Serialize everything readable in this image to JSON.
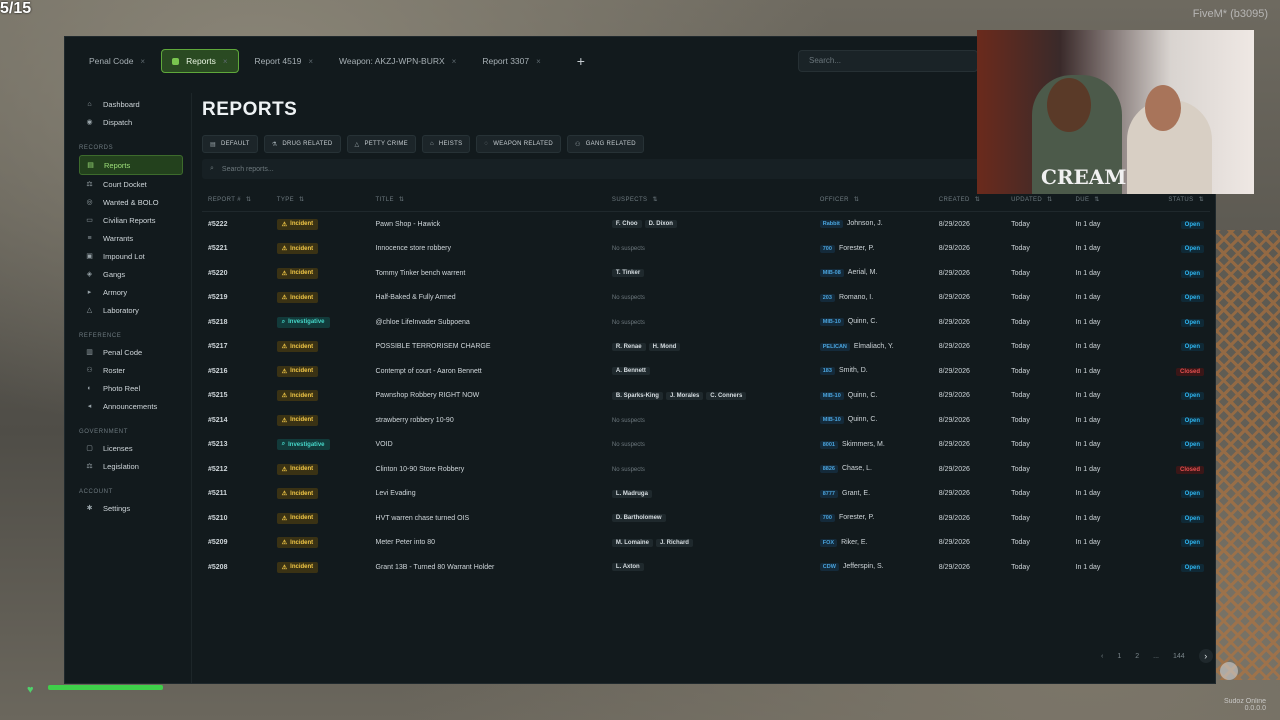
{
  "overlay": {
    "counter": "5/15",
    "server": "FiveM* (b3095)",
    "bottom_tag_1": "Sudoz Online",
    "bottom_tag_2": "0.0.0.0"
  },
  "webcam": {
    "shirt_text": "CREAM"
  },
  "tabs": [
    {
      "label": "Penal Code",
      "active": false
    },
    {
      "label": "Reports",
      "active": true
    },
    {
      "label": "Report 4519",
      "active": false
    },
    {
      "label": "Weapon: AKZJ-WPN-BURX",
      "active": false
    },
    {
      "label": "Report 3307",
      "active": false
    }
  ],
  "top_search_placeholder": "Search...",
  "sidebar": {
    "main": [
      {
        "label": "Dashboard",
        "icon": "home-icon"
      },
      {
        "label": "Dispatch",
        "icon": "radio-icon"
      }
    ],
    "records_title": "RECORDS",
    "records": [
      {
        "label": "Reports",
        "icon": "report-icon",
        "active": true
      },
      {
        "label": "Court Docket",
        "icon": "gavel-icon"
      },
      {
        "label": "Wanted & BOLO",
        "icon": "target-icon"
      },
      {
        "label": "Civilian Reports",
        "icon": "doc-icon"
      },
      {
        "label": "Warrants",
        "icon": "list-icon"
      },
      {
        "label": "Impound Lot",
        "icon": "car-icon"
      },
      {
        "label": "Gangs",
        "icon": "shield-icon"
      },
      {
        "label": "Armory",
        "icon": "gun-icon"
      },
      {
        "label": "Laboratory",
        "icon": "flask-icon"
      }
    ],
    "reference_title": "REFERENCE",
    "reference": [
      {
        "label": "Penal Code",
        "icon": "book-icon"
      },
      {
        "label": "Roster",
        "icon": "users-icon"
      },
      {
        "label": "Photo Reel",
        "icon": "camera-icon"
      },
      {
        "label": "Announcements",
        "icon": "megaphone-icon"
      }
    ],
    "government_title": "GOVERNMENT",
    "government": [
      {
        "label": "Licenses",
        "icon": "id-icon"
      },
      {
        "label": "Legislation",
        "icon": "scale-icon"
      }
    ],
    "account_title": "ACCOUNT",
    "account": [
      {
        "label": "Settings",
        "icon": "gear-icon"
      }
    ]
  },
  "page_title": "REPORTS",
  "filters": [
    "DEFAULT",
    "DRUG RELATED",
    "PETTY CRIME",
    "HEISTS",
    "WEAPON RELATED",
    "GANG RELATED"
  ],
  "search_reports_placeholder": "Search reports...",
  "columns": [
    "REPORT #",
    "TYPE",
    "TITLE",
    "SUSPECTS",
    "OFFICER",
    "CREATED",
    "UPDATED",
    "DUE",
    "STATUS"
  ],
  "rows": [
    {
      "id": "#5222",
      "type": "Incident",
      "title": "Pawn Shop - Hawick",
      "suspects": [
        "F. Choo",
        "D. Dixon"
      ],
      "callsign": "Rabbit",
      "officer": "Johnson, J.",
      "created": "8/29/2026",
      "updated": "Today",
      "due": "In 1 day",
      "status": "Open"
    },
    {
      "id": "#5221",
      "type": "Incident",
      "title": "Innocence store robbery",
      "suspects": [],
      "callsign": "700",
      "officer": "Forester, P.",
      "created": "8/29/2026",
      "updated": "Today",
      "due": "In 1 day",
      "status": "Open"
    },
    {
      "id": "#5220",
      "type": "Incident",
      "title": "Tommy Tinker bench warrent",
      "suspects": [
        "T. Tinker"
      ],
      "callsign": "MIB-08",
      "officer": "Aerial, M.",
      "created": "8/29/2026",
      "updated": "Today",
      "due": "In 1 day",
      "status": "Open"
    },
    {
      "id": "#5219",
      "type": "Incident",
      "title": "Half-Baked & Fully Armed",
      "suspects": [],
      "callsign": "203",
      "officer": "Romano, I.",
      "created": "8/29/2026",
      "updated": "Today",
      "due": "In 1 day",
      "status": "Open"
    },
    {
      "id": "#5218",
      "type": "Investigative",
      "title": "@chloe LifeInvader Subpoena",
      "suspects": [],
      "callsign": "MIB-10",
      "officer": "Quinn, C.",
      "created": "8/29/2026",
      "updated": "Today",
      "due": "In 1 day",
      "status": "Open"
    },
    {
      "id": "#5217",
      "type": "Incident",
      "title": "POSSIBLE TERRORISEM CHARGE",
      "suspects": [
        "R. Renae",
        "H. Mond"
      ],
      "callsign": "PELICAN",
      "officer": "Elmaliach, Y.",
      "created": "8/29/2026",
      "updated": "Today",
      "due": "In 1 day",
      "status": "Open"
    },
    {
      "id": "#5216",
      "type": "Incident",
      "title": "Contempt of court - Aaron Bennett",
      "suspects": [
        "A. Bennett"
      ],
      "callsign": "183",
      "officer": "Smith, D.",
      "created": "8/29/2026",
      "updated": "Today",
      "due": "In 1 day",
      "status": "Closed"
    },
    {
      "id": "#5215",
      "type": "Incident",
      "title": "Pawnshop Robbery RIGHT NOW",
      "suspects": [
        "B. Sparks-King",
        "J. Morales",
        "C. Conners"
      ],
      "callsign": "MIB-10",
      "officer": "Quinn, C.",
      "created": "8/29/2026",
      "updated": "Today",
      "due": "In 1 day",
      "status": "Open"
    },
    {
      "id": "#5214",
      "type": "Incident",
      "title": "strawberry robbery 10-90",
      "suspects": [],
      "callsign": "MIB-10",
      "officer": "Quinn, C.",
      "created": "8/29/2026",
      "updated": "Today",
      "due": "In 1 day",
      "status": "Open"
    },
    {
      "id": "#5213",
      "type": "Investigative",
      "title": "VOID",
      "suspects": [],
      "callsign": "8001",
      "officer": "Skimmers, M.",
      "created": "8/29/2026",
      "updated": "Today",
      "due": "In 1 day",
      "status": "Open"
    },
    {
      "id": "#5212",
      "type": "Incident",
      "title": "Clinton 10-90 Store Robbery",
      "suspects": [],
      "callsign": "8826",
      "officer": "Chase, L.",
      "created": "8/29/2026",
      "updated": "Today",
      "due": "In 1 day",
      "status": "Closed"
    },
    {
      "id": "#5211",
      "type": "Incident",
      "title": "Levi Evading",
      "suspects": [
        "L. Madruga"
      ],
      "callsign": "8777",
      "officer": "Grant, E.",
      "created": "8/29/2026",
      "updated": "Today",
      "due": "In 1 day",
      "status": "Open"
    },
    {
      "id": "#5210",
      "type": "Incident",
      "title": "HVT warren chase turned OIS",
      "suspects": [
        "D. Bartholomew"
      ],
      "callsign": "700",
      "officer": "Forester, P.",
      "created": "8/29/2026",
      "updated": "Today",
      "due": "In 1 day",
      "status": "Open"
    },
    {
      "id": "#5209",
      "type": "Incident",
      "title": "Meter Peter into 80",
      "suspects": [
        "M. Lomaine",
        "J. Richard"
      ],
      "callsign": "FOX",
      "officer": "Riker, E.",
      "created": "8/29/2026",
      "updated": "Today",
      "due": "In 1 day",
      "status": "Open"
    },
    {
      "id": "#5208",
      "type": "Incident",
      "title": "Grant 13B - Turned 80 Warrant Holder",
      "suspects": [
        "L. Axton"
      ],
      "callsign": "CDW",
      "officer": "Jefferspin, S.",
      "created": "8/29/2026",
      "updated": "Today",
      "due": "In 1 day",
      "status": "Open"
    }
  ],
  "no_suspects_label": "No suspects",
  "pagination": {
    "pages": [
      "1",
      "2",
      "...",
      "144"
    ]
  }
}
